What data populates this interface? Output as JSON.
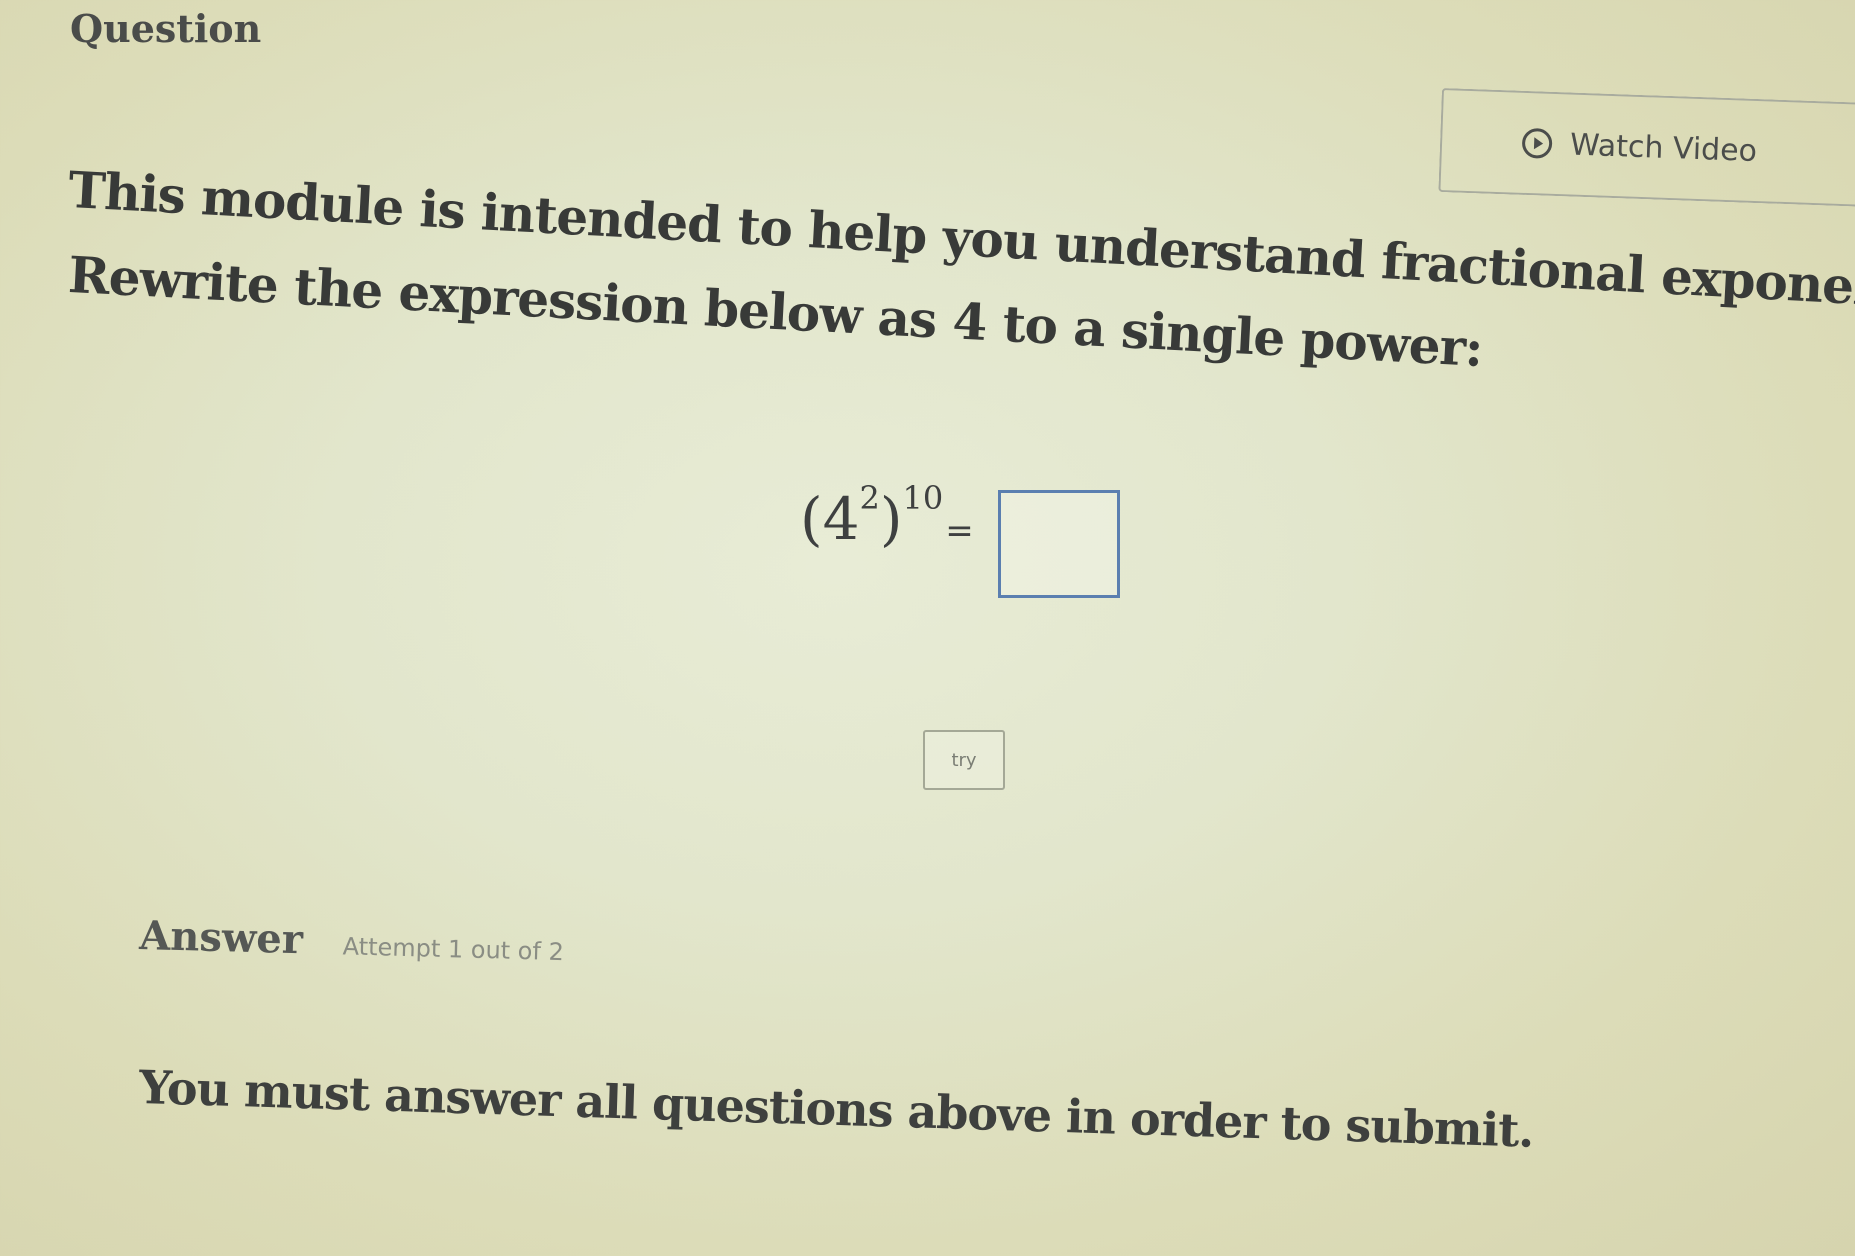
{
  "question": {
    "header": "Question",
    "watch_video_label": "Watch Video",
    "intro": "This module is intended to help you understand fractional exponents.",
    "prompt": "Rewrite the expression below as 4 to a single power:",
    "expression": {
      "base": "4",
      "inner_exponent": "2",
      "outer_exponent": "10",
      "equals": "="
    },
    "answer_value": "",
    "try_button_label": "try"
  },
  "answer": {
    "label": "Answer",
    "attempt": "Attempt 1 out of 2",
    "submit_note": "You must answer all questions above in order to submit."
  },
  "colors": {
    "answer_box_border": "#5b7fb0"
  }
}
